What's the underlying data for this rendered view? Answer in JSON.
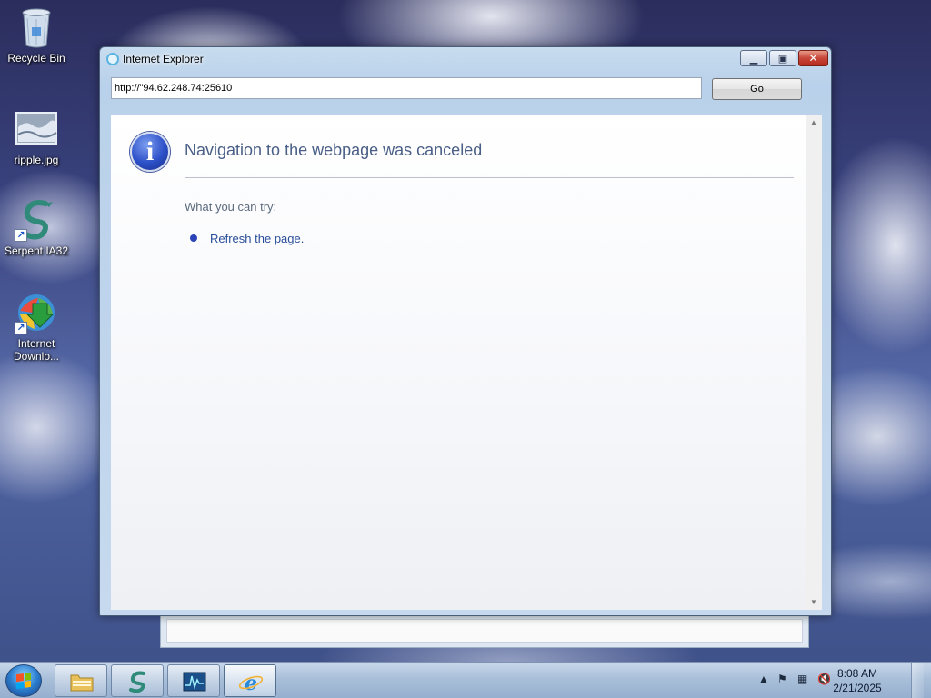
{
  "desktop": {
    "icons": [
      {
        "label": "Recycle Bin",
        "icon": "recycle-bin-icon"
      },
      {
        "label": "ripple.jpg",
        "icon": "image-file-icon"
      },
      {
        "label": "Serpent IA32",
        "icon": "serpent-icon"
      },
      {
        "label": "Internet Downlo...",
        "icon": "internet-download-manager-icon"
      }
    ]
  },
  "window": {
    "title": "Internet Explorer",
    "icon": "ie-icon",
    "caption_buttons": {
      "minimize": "minimize-icon",
      "maximize": "maximize-icon",
      "close": "close-icon"
    },
    "address": {
      "value": "http://\"94.62.248.74:25610"
    },
    "go_label": "Go",
    "page": {
      "icon": "info-icon",
      "title": "Navigation to the webpage was canceled",
      "try_heading": "What you can try:",
      "suggestions": [
        "Refresh the page."
      ]
    }
  },
  "taskbar": {
    "start": "start-orb-icon",
    "buttons": [
      {
        "name": "file-explorer",
        "icon": "folder-icon"
      },
      {
        "name": "serpent",
        "icon": "serpent-icon"
      },
      {
        "name": "resource-monitor",
        "icon": "monitor-icon"
      },
      {
        "name": "internet-explorer",
        "icon": "ie-icon",
        "active": true
      }
    ],
    "tray": {
      "icons": [
        "show-hidden-icons-chevron",
        "action-center-flag-icon",
        "network-icon",
        "volume-muted-icon"
      ],
      "time": "8:08 AM",
      "date": "2/21/2025"
    }
  },
  "colors": {
    "link": "#2a4e9a",
    "title_text": "#4a5f86",
    "close_button": "#c7463a",
    "info_blue": "#2c50c8"
  }
}
